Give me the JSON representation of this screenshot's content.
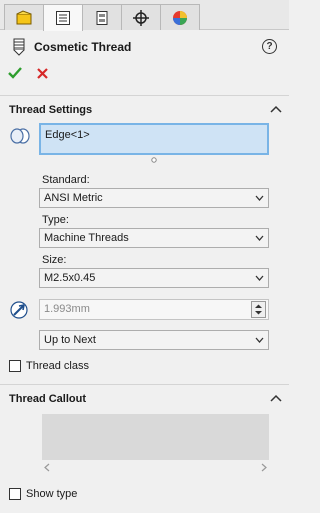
{
  "header": {
    "title": "Cosmetic Thread",
    "help": "?"
  },
  "tabs": [
    {
      "icon": "feature-manager-icon"
    },
    {
      "icon": "property-manager-icon"
    },
    {
      "icon": "configuration-manager-icon"
    },
    {
      "icon": "dimxpert-icon"
    },
    {
      "icon": "display-manager-icon"
    }
  ],
  "thread_settings": {
    "title": "Thread Settings",
    "edge_value": "Edge<1>",
    "standard_label": "Standard:",
    "standard_value": "ANSI Metric",
    "type_label": "Type:",
    "type_value": "Machine Threads",
    "size_label": "Size:",
    "size_value": "M2.5x0.45",
    "depth_value": "1.993mm",
    "end_condition_value": "Up to Next",
    "thread_class_label": "Thread class"
  },
  "thread_callout": {
    "title": "Thread Callout",
    "show_type_label": "Show type"
  }
}
